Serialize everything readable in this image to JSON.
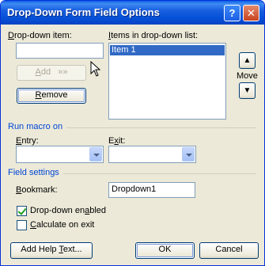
{
  "window": {
    "title": "Drop-Down Form Field Options",
    "help_label": "?",
    "close_label": "✕"
  },
  "dropdown_item": {
    "label_accel": "D",
    "label_rest": "rop-down item:",
    "value": ""
  },
  "add_button": {
    "label_accel": "A",
    "label_rest": "dd",
    "arrows": "»»"
  },
  "remove_button": {
    "label_accel": "R",
    "label_rest": "emove"
  },
  "items_list": {
    "label_accel": "I",
    "label_rest": "tems in drop-down list:",
    "items": [
      "Item 1"
    ]
  },
  "move": {
    "label": "Move",
    "up_glyph": "▲",
    "down_glyph": "▼"
  },
  "run_macro": {
    "section_label": "Run macro on",
    "entry_accel": "E",
    "entry_rest": "ntry:",
    "exit_pre": "E",
    "exit_accel": "x",
    "exit_rest": "it:",
    "entry_value": "",
    "exit_value": ""
  },
  "field_settings": {
    "section_label": "Field settings",
    "bookmark_accel": "B",
    "bookmark_rest": "ookmark:",
    "bookmark_value": "Dropdown1",
    "enabled_pre": "Drop-down en",
    "enabled_accel": "a",
    "enabled_rest": "bled",
    "enabled_checked": true,
    "calc_accel": "C",
    "calc_rest": "alculate on exit",
    "calc_checked": false
  },
  "footer": {
    "help_text_pre": "Add Help ",
    "help_text_accel": "T",
    "help_text_rest": "ext...",
    "ok_label": "OK",
    "cancel_label": "Cancel"
  }
}
